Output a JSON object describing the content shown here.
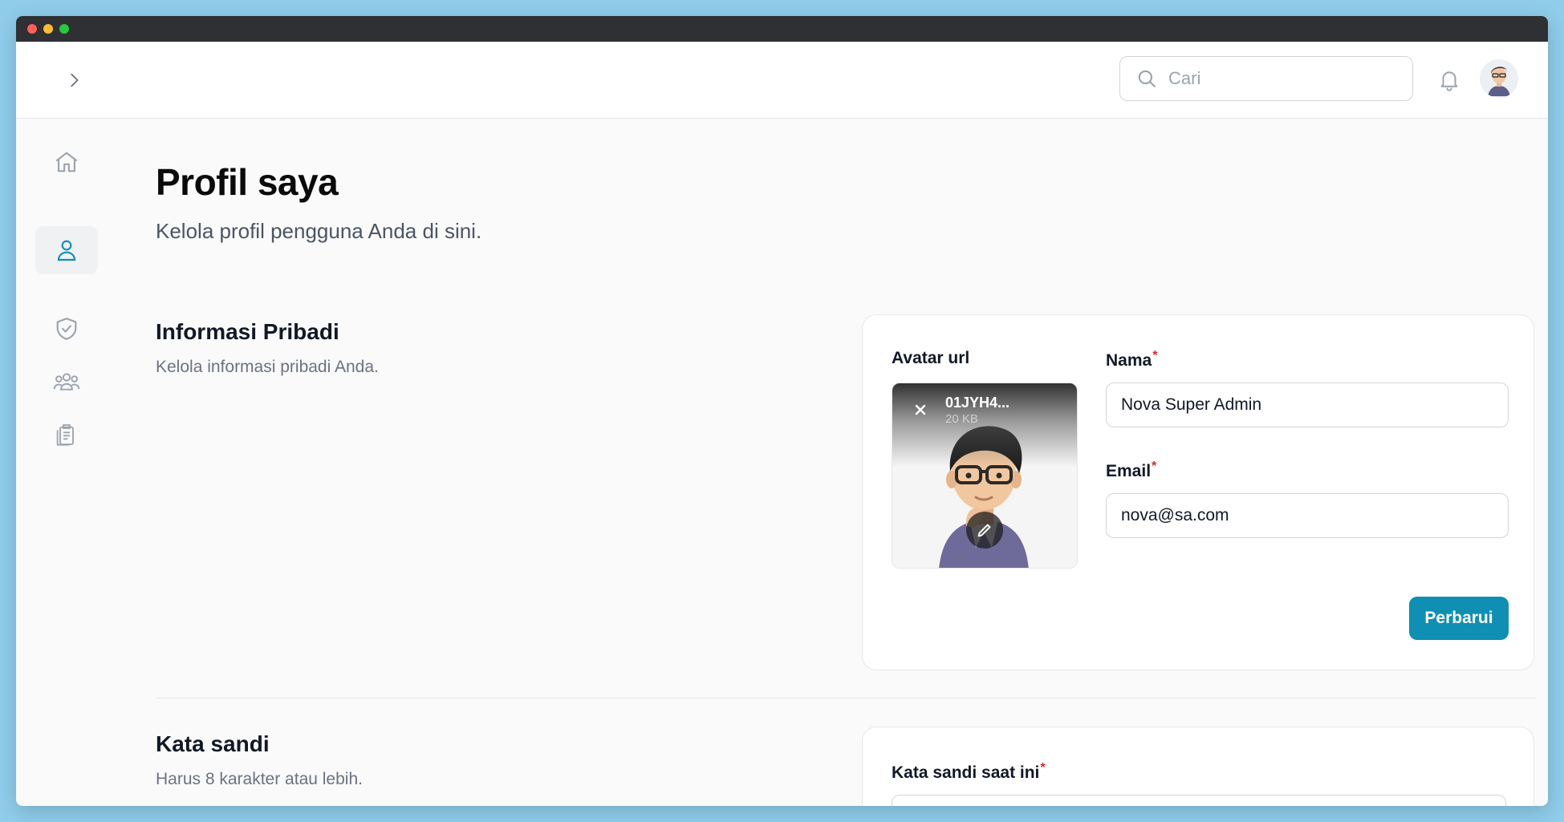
{
  "header": {
    "search_placeholder": "Cari"
  },
  "sidebar": {
    "items": [
      {
        "name": "home",
        "icon": "home-icon"
      },
      {
        "name": "profile",
        "icon": "user-icon",
        "active": true
      },
      {
        "name": "security",
        "icon": "shield-check-icon"
      },
      {
        "name": "users",
        "icon": "user-group-icon"
      },
      {
        "name": "reports",
        "icon": "clipboard-icon"
      }
    ]
  },
  "page": {
    "title": "Profil saya",
    "subtitle": "Kelola profil pengguna Anda di sini."
  },
  "personal_info": {
    "title": "Informasi Pribadi",
    "description": "Kelola informasi pribadi Anda.",
    "avatar_label": "Avatar url",
    "avatar_file_name": "01JYH4...",
    "avatar_file_size": "20 KB",
    "name_label": "Nama",
    "name_value": "Nova Super Admin",
    "email_label": "Email",
    "email_value": "nova@sa.com",
    "required_mark": "*",
    "submit_label": "Perbarui"
  },
  "password": {
    "title": "Kata sandi",
    "description": "Harus 8 karakter atau lebih.",
    "current_label": "Kata sandi saat ini",
    "current_value": ""
  },
  "colors": {
    "accent": "#0e8fb3",
    "active_icon": "#0e8fb3",
    "required": "#dc2626"
  }
}
